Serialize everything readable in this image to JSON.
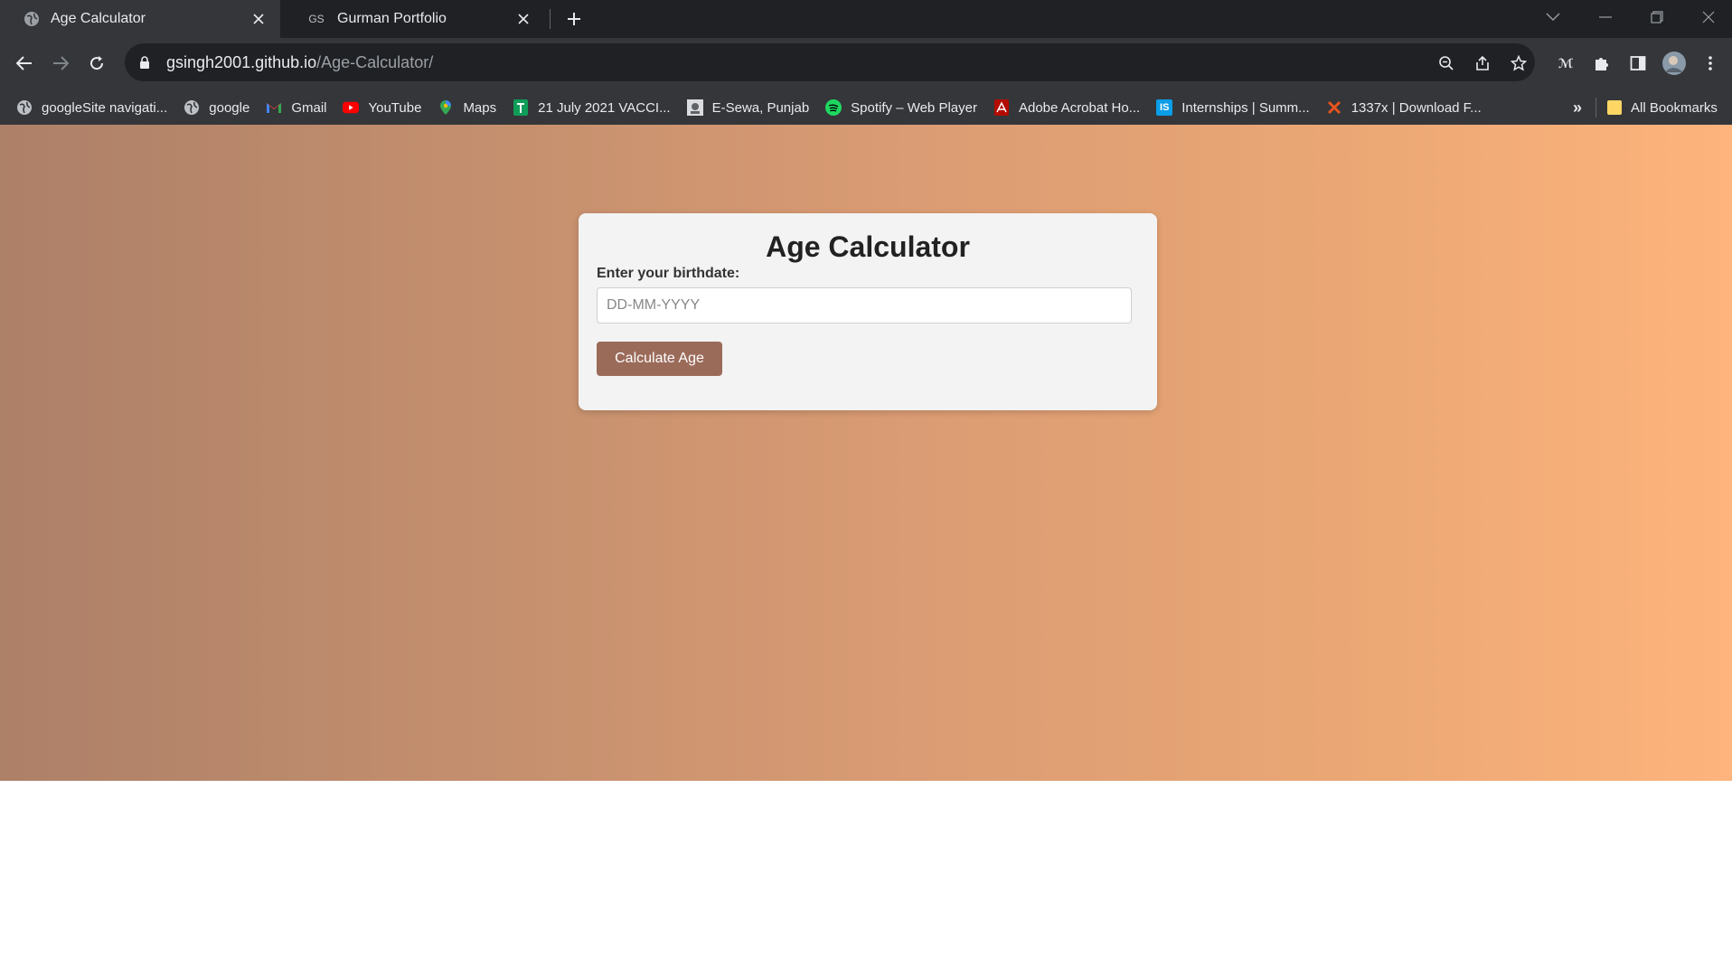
{
  "browser": {
    "tabs": [
      {
        "title": "Age Calculator",
        "favicon": "globe-icon",
        "active": true
      },
      {
        "title": "Gurman Portfolio",
        "favicon": "GS",
        "active": false
      }
    ],
    "address": {
      "host": "gsingh2001.github.io",
      "path": "/Age-Calculator/"
    },
    "bookmarks": [
      {
        "label": "googleSite navigati...",
        "icon": "globe-icon"
      },
      {
        "label": "google",
        "icon": "globe-icon"
      },
      {
        "label": "Gmail",
        "icon": "gmail-icon"
      },
      {
        "label": "YouTube",
        "icon": "youtube-icon"
      },
      {
        "label": "Maps",
        "icon": "maps-pin-icon"
      },
      {
        "label": "21 July 2021 VACCI...",
        "icon": "sheets-icon"
      },
      {
        "label": "E-Sewa, Punjab",
        "icon": "emblem-icon"
      },
      {
        "label": "Spotify – Web Player",
        "icon": "spotify-icon"
      },
      {
        "label": "Adobe Acrobat Ho...",
        "icon": "acrobat-icon"
      },
      {
        "label": "Internships | Summ...",
        "icon": "internshala-icon"
      },
      {
        "label": "1337x | Download F...",
        "icon": "x-logo-icon"
      }
    ],
    "overflow_label": "»",
    "all_bookmarks_label": "All Bookmarks"
  },
  "app": {
    "title": "Age Calculator",
    "birthdate_label": "Enter your birthdate:",
    "birthdate_placeholder": "DD-MM-YYYY",
    "birthdate_value": "",
    "calculate_label": "Calculate Age"
  },
  "colors": {
    "gradient_start": "#ad8068",
    "gradient_end": "#feb47c",
    "button": "#9b6b5a",
    "card": "#f3f3f3"
  }
}
